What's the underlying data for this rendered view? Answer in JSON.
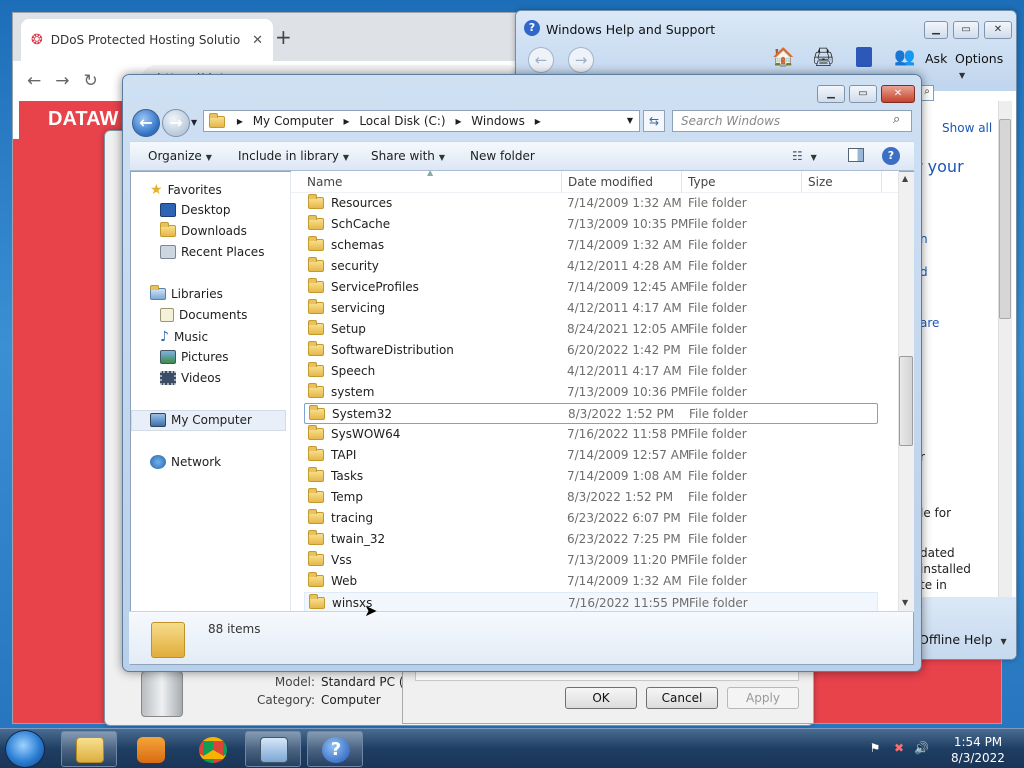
{
  "browser": {
    "tab_title": "DDoS Protected Hosting Solutio",
    "url": "https://datawagon.com",
    "brand": "DATAW",
    "newtab": "+",
    "back": "←",
    "forward": "→",
    "reload": "↻"
  },
  "help": {
    "title": "Windows Help and Support",
    "ask": "Ask",
    "options": "Options",
    "show_all": "Show all",
    "frag_your": "r your",
    "frag_n": "n",
    "frag_d": "d",
    "frag_are": "are",
    "frag_r": "r",
    "frag_lefor": "le for",
    "frag_dated": "dated",
    "frag_installed": "installed",
    "frag_tein": "te in",
    "offline": "Offline Help"
  },
  "sysprop": {
    "model_label": "Model:",
    "model_value": "Standard PC (Q",
    "category_label": "Category:",
    "category_value": "Computer",
    "ok": "OK",
    "cancel": "Cancel",
    "apply": "Apply"
  },
  "explorer": {
    "breadcrumb": [
      "My Computer",
      "Local Disk (C:)",
      "Windows"
    ],
    "search_placeholder": "Search Windows",
    "commands": {
      "organize": "Organize",
      "include": "Include in library",
      "share": "Share with",
      "newfolder": "New folder"
    },
    "nav": {
      "favorites": "Favorites",
      "desktop": "Desktop",
      "downloads": "Downloads",
      "recent": "Recent Places",
      "libraries": "Libraries",
      "documents": "Documents",
      "music": "Music",
      "pictures": "Pictures",
      "videos": "Videos",
      "mycomputer": "My Computer",
      "network": "Network"
    },
    "columns": {
      "name": "Name",
      "date": "Date modified",
      "type": "Type",
      "size": "Size"
    },
    "rows": [
      {
        "name": "Resources",
        "date": "7/14/2009 1:32 AM",
        "type": "File folder"
      },
      {
        "name": "SchCache",
        "date": "7/13/2009 10:35 PM",
        "type": "File folder"
      },
      {
        "name": "schemas",
        "date": "7/14/2009 1:32 AM",
        "type": "File folder"
      },
      {
        "name": "security",
        "date": "4/12/2011 4:28 AM",
        "type": "File folder"
      },
      {
        "name": "ServiceProfiles",
        "date": "7/14/2009 12:45 AM",
        "type": "File folder"
      },
      {
        "name": "servicing",
        "date": "4/12/2011 4:17 AM",
        "type": "File folder"
      },
      {
        "name": "Setup",
        "date": "8/24/2021 12:05 AM",
        "type": "File folder"
      },
      {
        "name": "SoftwareDistribution",
        "date": "6/20/2022 1:42 PM",
        "type": "File folder"
      },
      {
        "name": "Speech",
        "date": "4/12/2011 4:17 AM",
        "type": "File folder"
      },
      {
        "name": "system",
        "date": "7/13/2009 10:36 PM",
        "type": "File folder"
      },
      {
        "name": "System32",
        "date": "8/3/2022 1:52 PM",
        "type": "File folder"
      },
      {
        "name": "SysWOW64",
        "date": "7/16/2022 11:58 PM",
        "type": "File folder"
      },
      {
        "name": "TAPI",
        "date": "7/14/2009 12:57 AM",
        "type": "File folder"
      },
      {
        "name": "Tasks",
        "date": "7/14/2009 1:08 AM",
        "type": "File folder"
      },
      {
        "name": "Temp",
        "date": "8/3/2022 1:52 PM",
        "type": "File folder"
      },
      {
        "name": "tracing",
        "date": "6/23/2022 6:07 PM",
        "type": "File folder"
      },
      {
        "name": "twain_32",
        "date": "6/23/2022 7:25 PM",
        "type": "File folder"
      },
      {
        "name": "Vss",
        "date": "7/13/2009 11:20 PM",
        "type": "File folder"
      },
      {
        "name": "Web",
        "date": "7/14/2009 1:32 AM",
        "type": "File folder"
      },
      {
        "name": "winsxs",
        "date": "7/16/2022 11:55 PM",
        "type": "File folder"
      }
    ],
    "item_count": "88 items"
  },
  "taskbar": {
    "time": "1:54 PM",
    "date": "8/3/2022"
  }
}
